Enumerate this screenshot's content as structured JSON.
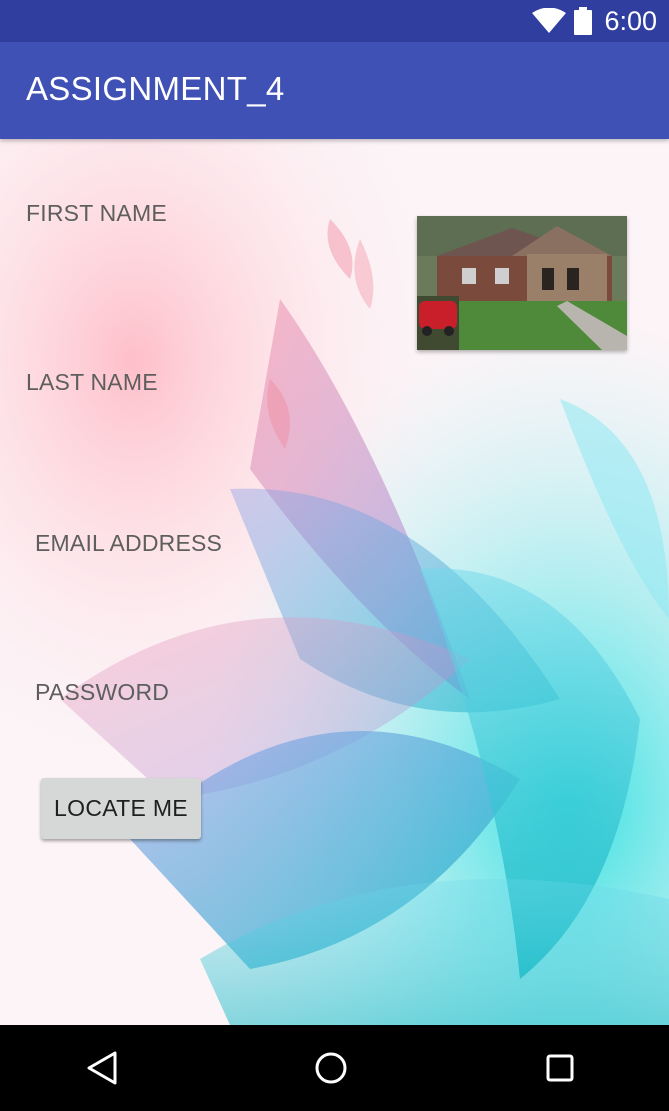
{
  "status_bar": {
    "time": "6:00",
    "icons": [
      "wifi-icon",
      "battery-icon"
    ],
    "color": "#303F9F"
  },
  "app_bar": {
    "title": "ASSIGNMENT_4",
    "color": "#3F51B5"
  },
  "form": {
    "first_name_label": "FIRST NAME",
    "last_name_label": "LAST NAME",
    "email_label": "EMAIL ADDRESS",
    "password_label": "PASSWORD"
  },
  "photo": {
    "icon": "house-photo"
  },
  "locate_button": {
    "label": "LOCATE ME"
  },
  "nav_bar": {
    "icons": [
      "back-icon",
      "home-icon",
      "recents-icon"
    ]
  }
}
